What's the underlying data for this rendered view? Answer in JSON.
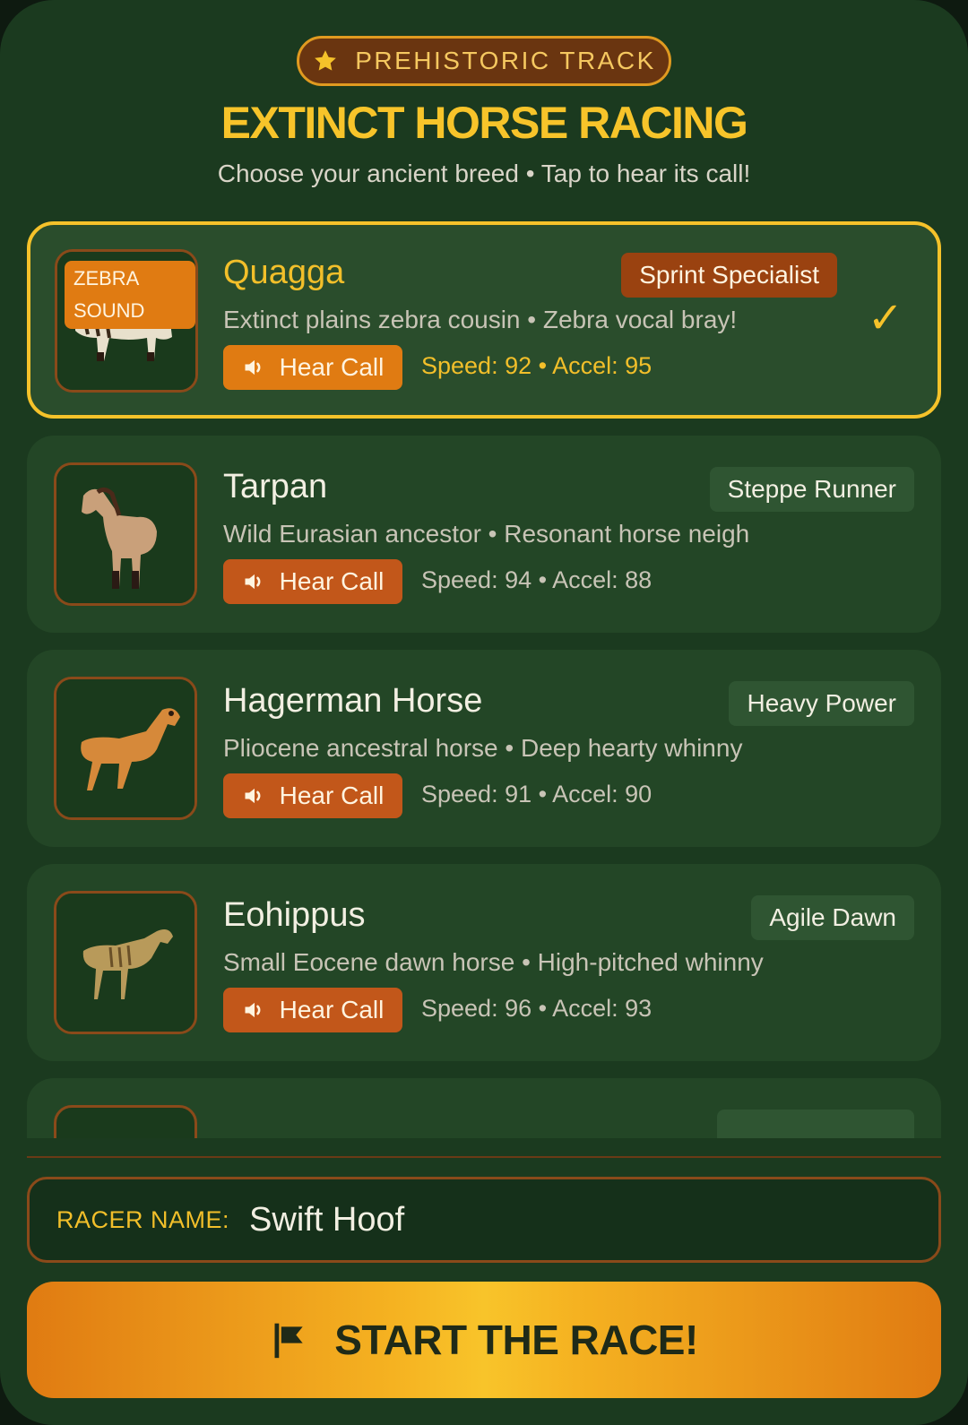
{
  "header": {
    "badge_label": "PREHISTORIC TRACK",
    "badge_icon": "star-icon",
    "title": "EXTINCT HORSE RACING",
    "subtitle": "Choose your ancient breed • Tap to hear its call!"
  },
  "breeds": [
    {
      "name": "Quagga",
      "tag": "Sprint Specialist",
      "description": "Extinct plains zebra cousin • Zebra vocal bray!",
      "button_label": "Hear Call",
      "stats": "Speed: 92 • Accel: 95",
      "thumb_overlay_line1": "ZEBRA",
      "thumb_overlay_line2": "SOUND",
      "selected": true,
      "check_glyph": "✓"
    },
    {
      "name": "Tarpan",
      "tag": "Steppe Runner",
      "description": "Wild Eurasian ancestor • Resonant horse neigh",
      "button_label": "Hear Call",
      "stats": "Speed: 94 • Accel: 88",
      "selected": false
    },
    {
      "name": "Hagerman Horse",
      "tag": "Heavy Power",
      "description": "Pliocene ancestral horse • Deep hearty whinny",
      "button_label": "Hear Call",
      "stats": "Speed: 91 • Accel: 90",
      "selected": false
    },
    {
      "name": "Eohippus",
      "tag": "Agile Dawn",
      "description": "Small Eocene dawn horse • High-pitched whinny",
      "button_label": "Hear Call",
      "stats": "Speed: 96 • Accel: 93",
      "selected": false
    }
  ],
  "racer": {
    "label": "RACER NAME:",
    "value": "Swift Hoof"
  },
  "start_button": {
    "label": "START THE RACE!",
    "icon": "flag-icon"
  },
  "colors": {
    "background": "#1b3a1f",
    "accent": "#f5c22a",
    "button_orange": "#c2571a"
  }
}
